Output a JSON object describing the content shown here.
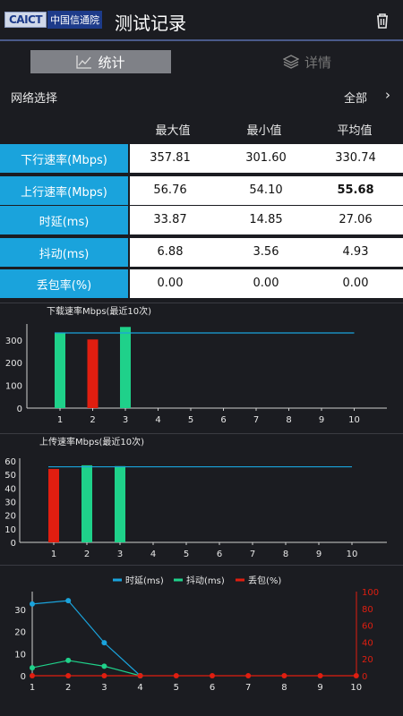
{
  "header": {
    "logo_en": "CAICT",
    "logo_cn": "中国信通院",
    "title": "测试记录"
  },
  "tabs": [
    {
      "label": "统计"
    },
    {
      "label": "详情"
    }
  ],
  "network": {
    "label": "网络选择",
    "value": "全部"
  },
  "table": {
    "headers": [
      "最大值",
      "最小值",
      "平均值"
    ],
    "rows": [
      {
        "label": "下行速率(Mbps)",
        "max": "357.81",
        "min": "301.60",
        "avg": "330.74"
      },
      {
        "label": "上行速率(Mbps)",
        "max": "56.76",
        "min": "54.10",
        "avg": "55.68"
      },
      {
        "label": "时延(ms)",
        "max": "33.87",
        "min": "14.85",
        "avg": "27.06"
      },
      {
        "label": "抖动(ms)",
        "max": "6.88",
        "min": "3.56",
        "avg": "4.93"
      },
      {
        "label": "丢包率(%)",
        "max": "0.00",
        "min": "0.00",
        "avg": "0.00"
      }
    ]
  },
  "colors": {
    "green": "#1fd18a",
    "red": "#e01e10",
    "blue": "#1aa3dc"
  },
  "chart_data": [
    {
      "type": "bar",
      "title": "下载速率Mbps(最近10次)",
      "categories": [
        "1",
        "2",
        "3",
        "4",
        "5",
        "6",
        "7",
        "8",
        "9",
        "10"
      ],
      "values": [
        330,
        302,
        357,
        null,
        null,
        null,
        null,
        null,
        null,
        null
      ],
      "bar_colors": [
        "#1fd18a",
        "#e01e10",
        "#1fd18a"
      ],
      "avg_line": 330.74,
      "yticks": [
        0,
        100,
        200,
        300
      ],
      "ylim": [
        0,
        370
      ]
    },
    {
      "type": "bar",
      "title": "上传速率Mbps(最近10次)",
      "categories": [
        "1",
        "2",
        "3",
        "4",
        "5",
        "6",
        "7",
        "8",
        "9",
        "10"
      ],
      "values": [
        54.1,
        56.8,
        56.2,
        null,
        null,
        null,
        null,
        null,
        null,
        null
      ],
      "bar_colors": [
        "#e01e10",
        "#1fd18a",
        "#1fd18a"
      ],
      "avg_line": 55.68,
      "yticks": [
        0,
        10,
        20,
        30,
        40,
        50,
        60
      ],
      "ylim": [
        0,
        62
      ]
    },
    {
      "type": "line",
      "categories": [
        "1",
        "2",
        "3",
        "4",
        "5",
        "6",
        "7",
        "8",
        "9",
        "10"
      ],
      "series": [
        {
          "name": "时延(ms)",
          "color": "#1aa3dc",
          "axis": "left",
          "values": [
            32.4,
            33.9,
            14.9,
            0
          ]
        },
        {
          "name": "抖动(ms)",
          "color": "#1fd18a",
          "axis": "left",
          "values": [
            3.6,
            6.9,
            4.3,
            0
          ]
        },
        {
          "name": "丢包(%)",
          "color": "#e01e10",
          "axis": "right",
          "values": [
            0,
            0,
            0,
            0,
            0,
            0,
            0,
            0,
            0,
            0
          ]
        }
      ],
      "yticks_left": [
        0,
        10,
        20,
        30
      ],
      "ylim_left": [
        0,
        38
      ],
      "yticks_right": [
        0,
        20,
        40,
        60,
        80,
        100
      ],
      "ylim_right": [
        0,
        100
      ]
    }
  ]
}
